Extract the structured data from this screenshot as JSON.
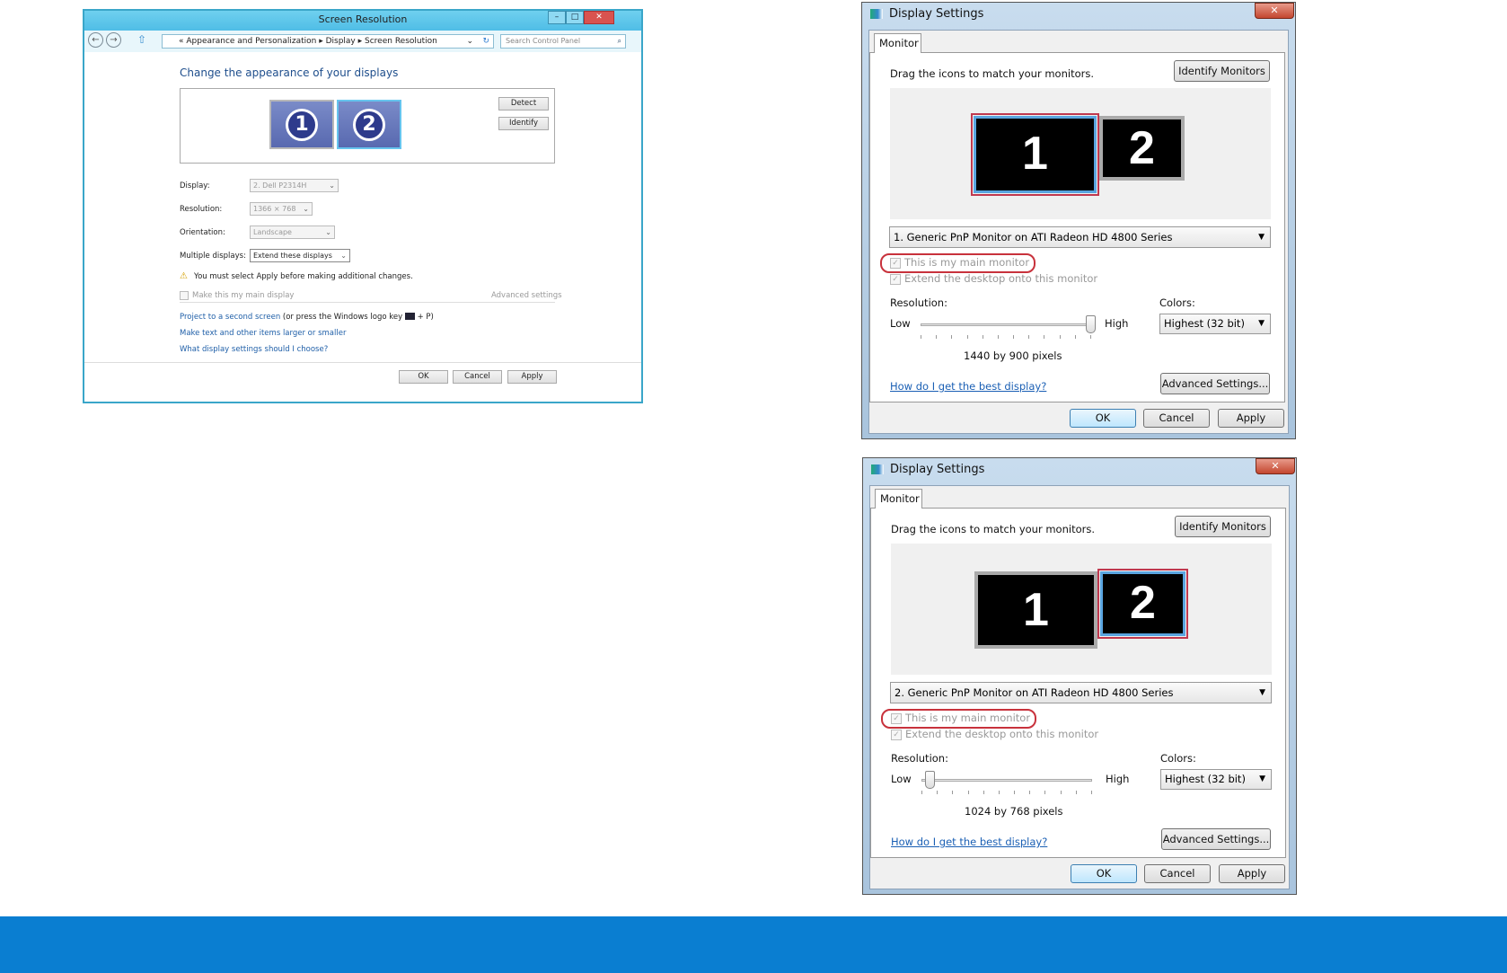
{
  "win8": {
    "title": "Screen Resolution",
    "breadcrumb": [
      "Appearance and Personalization",
      "Display",
      "Screen Resolution"
    ],
    "breadcrumb_prefix": "«",
    "search_placeholder": "Search Control Panel",
    "heading": "Change the appearance of your displays",
    "monitors": [
      "1",
      "2"
    ],
    "selected_monitor": "2",
    "detect_label": "Detect",
    "identify_label": "Identify",
    "display_label": "Display:",
    "display_value": "2. Dell P2314H",
    "resolution_label": "Resolution:",
    "resolution_value": "1366 × 768",
    "orientation_label": "Orientation:",
    "orientation_value": "Landscape",
    "multiple_label": "Multiple displays:",
    "multiple_value": "Extend these displays",
    "warning": "You must select Apply before making additional changes.",
    "main_display_label": "Make this my main display",
    "advanced_link": "Advanced settings",
    "project_link": "Project to a second screen",
    "project_hint": "(or press the Windows logo key",
    "project_hint_end": "+ P)",
    "text_size_link": "Make text and other items larger or smaller",
    "help_link": "What display settings should I choose?",
    "ok": "OK",
    "cancel": "Cancel",
    "apply": "Apply"
  },
  "dialogs": [
    {
      "title": "Display Settings",
      "tab": "Monitor",
      "drag_text": "Drag the icons to match your monitors.",
      "identify": "Identify Monitors",
      "monitors": [
        "1",
        "2"
      ],
      "selected_monitor": 1,
      "monitor_select": "1. Generic PnP Monitor on ATI Radeon HD 4800 Series",
      "main_monitor": "This is my main monitor",
      "main_monitor_checked": true,
      "extend": "Extend the desktop onto this monitor",
      "extend_checked": true,
      "resolution_label": "Resolution:",
      "low": "Low",
      "high": "High",
      "slider_fraction": 1.0,
      "pixels": "1440 by 900 pixels",
      "colors_label": "Colors:",
      "colors_value": "Highest (32 bit)",
      "help_link": "How do I get the best display?",
      "advanced": "Advanced Settings...",
      "ok": "OK",
      "cancel": "Cancel",
      "apply": "Apply"
    },
    {
      "title": "Display Settings",
      "tab": "Monitor",
      "drag_text": "Drag the icons to match your monitors.",
      "identify": "Identify Monitors",
      "monitors": [
        "1",
        "2"
      ],
      "selected_monitor": 2,
      "monitor_select": "2. Generic PnP Monitor on ATI Radeon HD 4800 Series",
      "main_monitor": "This is my main monitor",
      "main_monitor_checked": true,
      "extend": "Extend the desktop onto this monitor",
      "extend_checked": true,
      "resolution_label": "Resolution:",
      "low": "Low",
      "high": "High",
      "slider_fraction": 0.05,
      "pixels": "1024 by 768 pixels",
      "colors_label": "Colors:",
      "colors_value": "Highest (32 bit)",
      "help_link": "How do I get the best display?",
      "advanced": "Advanced Settings...",
      "ok": "OK",
      "cancel": "Cancel",
      "apply": "Apply"
    }
  ],
  "colors": {
    "band": "#0a7ed1",
    "highlight": "#c8323c",
    "link": "#1a5fb4"
  }
}
